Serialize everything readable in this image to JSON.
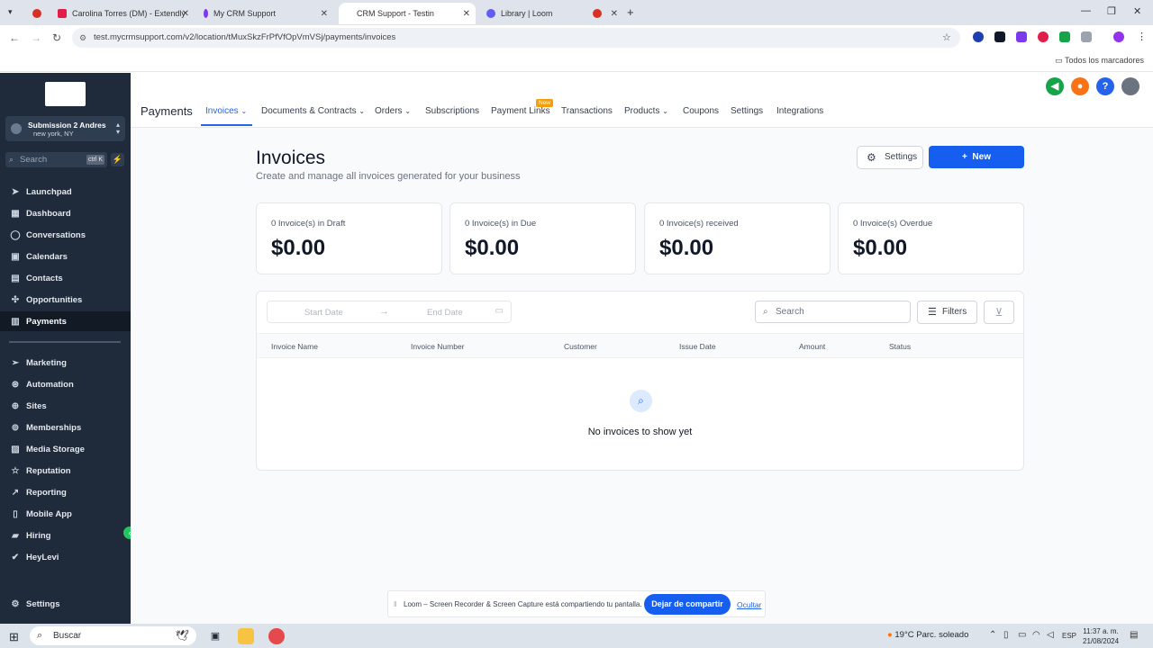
{
  "browser": {
    "tabs": [
      {
        "label": "",
        "favicon_color": "#d93025"
      },
      {
        "label": "Carolina Torres (DM) - Extendly",
        "favicon_color": "#e11d48"
      },
      {
        "label": "My CRM Support",
        "favicon_color": "#7c3aed"
      },
      {
        "label": "CRM Support - Testin",
        "favicon_color": "#ffffff",
        "active": true
      },
      {
        "label": "Library | Loom",
        "favicon_color": "#625df5"
      },
      {
        "label": "",
        "favicon_color": "#d93025"
      }
    ],
    "url": "test.mycrmsupport.com/v2/location/tMuxSkzFrPfVfOpVmVSj/payments/invoices",
    "bookmarks_label": "Todos los marcadores"
  },
  "sidebar": {
    "account_name": "Submission 2 Andres",
    "account_location": "new york, NY",
    "search_placeholder": "Search",
    "search_shortcut": "ctrl K",
    "items_top": [
      {
        "label": "Launchpad",
        "icon": "launchpad-icon",
        "glyph": "➤"
      },
      {
        "label": "Dashboard",
        "icon": "dashboard-icon",
        "glyph": "▦"
      },
      {
        "label": "Conversations",
        "icon": "chat-icon",
        "glyph": "◯"
      },
      {
        "label": "Calendars",
        "icon": "calendar-icon",
        "glyph": "▣"
      },
      {
        "label": "Contacts",
        "icon": "contacts-icon",
        "glyph": "▤"
      },
      {
        "label": "Opportunities",
        "icon": "opportunities-icon",
        "glyph": "✣"
      },
      {
        "label": "Payments",
        "icon": "payments-icon",
        "glyph": "▥",
        "active": true
      }
    ],
    "items_bottom": [
      {
        "label": "Marketing",
        "icon": "marketing-icon",
        "glyph": "➢"
      },
      {
        "label": "Automation",
        "icon": "automation-icon",
        "glyph": "⊛"
      },
      {
        "label": "Sites",
        "icon": "sites-icon",
        "glyph": "⊕"
      },
      {
        "label": "Memberships",
        "icon": "memberships-icon",
        "glyph": "⊚"
      },
      {
        "label": "Media Storage",
        "icon": "media-storage-icon",
        "glyph": "▨"
      },
      {
        "label": "Reputation",
        "icon": "reputation-icon",
        "glyph": "☆"
      },
      {
        "label": "Reporting",
        "icon": "reporting-icon",
        "glyph": "↗"
      },
      {
        "label": "Mobile App",
        "icon": "mobile-app-icon",
        "glyph": "▯"
      },
      {
        "label": "Hiring",
        "icon": "hiring-icon",
        "glyph": "▰"
      },
      {
        "label": "HeyLevi",
        "icon": "check-icon",
        "glyph": "✔"
      }
    ],
    "settings_label": "Settings"
  },
  "topnav": {
    "page_label": "Payments",
    "items": [
      {
        "label": "Invoices",
        "dropdown": true,
        "active": true
      },
      {
        "label": "Documents & Contracts",
        "dropdown": true
      },
      {
        "label": "Orders",
        "dropdown": true
      },
      {
        "label": "Subscriptions"
      },
      {
        "label": "Payment Links"
      },
      {
        "label": "Transactions"
      },
      {
        "label": "Products",
        "dropdown": true
      },
      {
        "label": "Coupons"
      },
      {
        "label": "Settings"
      },
      {
        "label": "Integrations"
      }
    ],
    "new_badge": "New"
  },
  "main": {
    "title": "Invoices",
    "subtitle": "Create and manage all invoices generated for your business",
    "settings_button": "Settings",
    "new_button": "New",
    "cards": [
      {
        "label": "0 Invoice(s) in Draft",
        "value": "$0.00"
      },
      {
        "label": "0 Invoice(s) in Due",
        "value": "$0.00"
      },
      {
        "label": "0 Invoice(s) received",
        "value": "$0.00"
      },
      {
        "label": "0 Invoice(s) Overdue",
        "value": "$0.00"
      }
    ],
    "start_date_placeholder": "Start Date",
    "end_date_placeholder": "End Date",
    "search_placeholder": "Search",
    "filters_button": "Filters",
    "columns": [
      "Invoice Name",
      "Invoice Number",
      "Customer",
      "Issue Date",
      "Amount",
      "Status"
    ],
    "empty_message": "No invoices to show yet"
  },
  "loom": {
    "message": "Loom – Screen Recorder & Screen Capture está compartiendo tu pantalla.",
    "stop_button": "Dejar de compartir",
    "hide_link": "Ocultar"
  },
  "taskbar": {
    "search_placeholder": "Buscar",
    "weather_temp": "19°C",
    "weather_desc": "Parc. soleado",
    "language": "ESP",
    "time": "11:37 a. m.",
    "date": "21/08/2024"
  },
  "colors": {
    "accent": "#155eef",
    "sidebar_bg": "#1f2b3a",
    "new_badge": "#f59e0b"
  }
}
